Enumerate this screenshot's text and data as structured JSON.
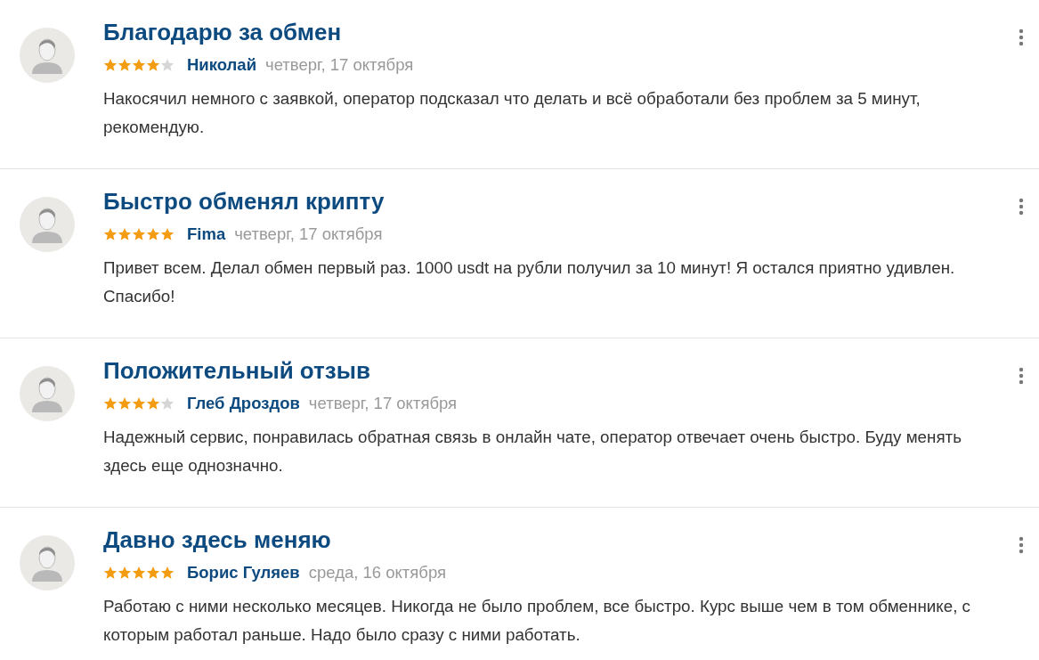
{
  "reviews": [
    {
      "title": "Благодарю за обмен",
      "stars": 4,
      "author": "Николай",
      "date": "четверг, 17 октября",
      "text": "Накосячил немного с заявкой, оператор подсказал что делать и всё обработали без проблем за 5 минут, рекомендую."
    },
    {
      "title": "Быстро обменял крипту",
      "stars": 5,
      "author": "Fima",
      "date": "четверг, 17 октября",
      "text": "Привет всем. Делал обмен первый раз. 1000 usdt на рубли получил за 10 минут! Я остался приятно удивлен. Спасибо!"
    },
    {
      "title": "Положительный отзыв",
      "stars": 4,
      "author": "Глеб Дроздов",
      "date": "четверг, 17 октября",
      "text": "Надежный сервис, понравилась обратная связь в онлайн чате, оператор отвечает очень быстро. Буду менять здесь еще однозначно."
    },
    {
      "title": "Давно здесь меняю",
      "stars": 5,
      "author": "Борис Гуляев",
      "date": "среда, 16 октября",
      "text": "Работаю с ними несколько месяцев. Никогда не было проблем, все быстро. Курс выше чем в том обменнике, с которым работал раньше. Надо было сразу с ними работать."
    }
  ]
}
